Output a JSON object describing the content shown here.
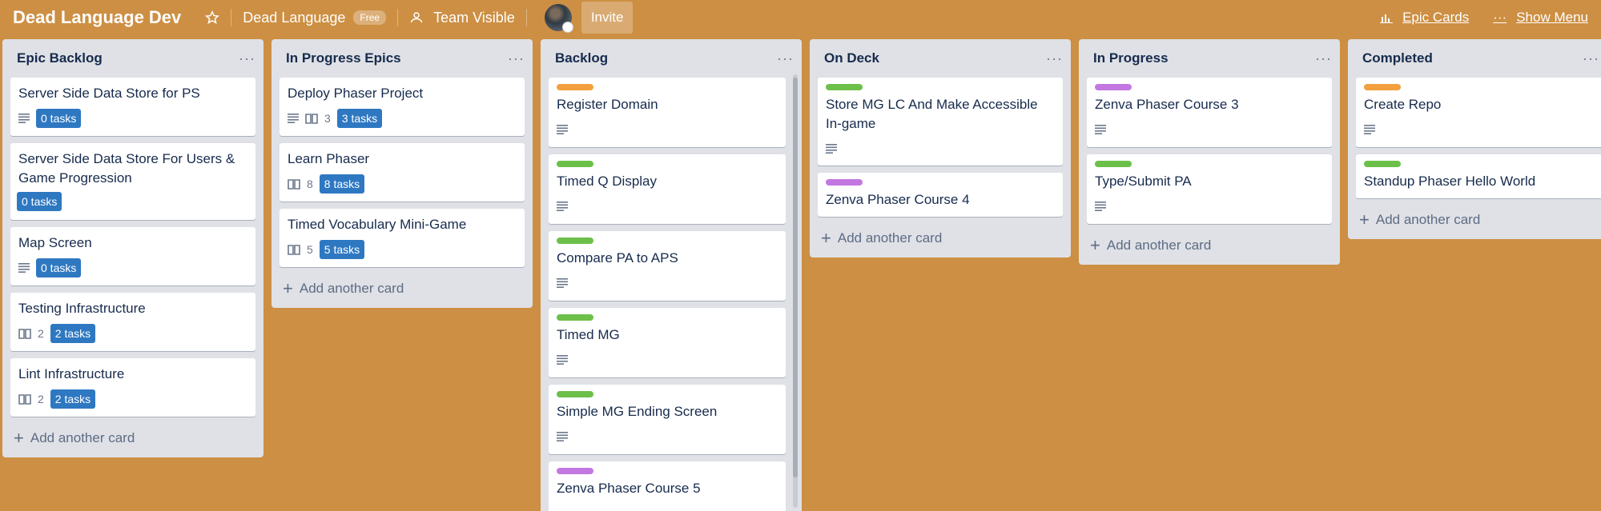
{
  "header": {
    "board_title": "Dead Language Dev",
    "team_name": "Dead Language",
    "free_badge": "Free",
    "visibility": "Team Visible",
    "invite_label": "Invite",
    "epic_cards_label": "Epic Cards",
    "show_menu_label": "Show Menu"
  },
  "colors": {
    "background": "#cd8f43",
    "label_orange": "#f2a03d",
    "label_green": "#6cc04a",
    "label_purple": "#c377e0",
    "task_badge": "#2e78c2"
  },
  "add_card_label": "Add another card",
  "lists": [
    {
      "title": "Epic Backlog",
      "cards": [
        {
          "title": "Server Side Data Store for PS",
          "tasks": "0 tasks"
        },
        {
          "title": "Server Side Data Store For Users & Game Progression",
          "tasks": "0 tasks"
        },
        {
          "title": "Map Screen",
          "tasks": "0 tasks"
        },
        {
          "title": "Testing Infrastructure",
          "checklist": "2",
          "tasks": "2 tasks"
        },
        {
          "title": "Lint Infrastructure",
          "checklist": "2",
          "tasks": "2 tasks"
        }
      ]
    },
    {
      "title": "In Progress Epics",
      "cards": [
        {
          "title": "Deploy Phaser Project",
          "checklist": "3",
          "tasks": "3 tasks"
        },
        {
          "title": "Learn Phaser",
          "checklist": "8",
          "tasks": "8 tasks"
        },
        {
          "title": "Timed Vocabulary Mini-Game",
          "checklist": "5",
          "tasks": "5 tasks"
        }
      ]
    },
    {
      "title": "Backlog",
      "cards": [
        {
          "title": "Register Domain",
          "label": "orange"
        },
        {
          "title": "Timed Q Display",
          "label": "green"
        },
        {
          "title": "Compare PA to APS",
          "label": "green"
        },
        {
          "title": "Timed MG",
          "label": "green"
        },
        {
          "title": "Simple MG Ending Screen",
          "label": "green"
        },
        {
          "title": "Zenva Phaser Course 5",
          "label": "purple"
        }
      ]
    },
    {
      "title": "On Deck",
      "cards": [
        {
          "title": "Store MG LC And Make Accessible In-game",
          "label": "green"
        },
        {
          "title": "Zenva Phaser Course 4",
          "label": "purple"
        }
      ]
    },
    {
      "title": "In Progress",
      "cards": [
        {
          "title": "Zenva Phaser Course 3",
          "label": "purple"
        },
        {
          "title": "Type/Submit PA",
          "label": "green"
        }
      ]
    },
    {
      "title": "Completed",
      "cards": [
        {
          "title": "Create Repo",
          "label": "orange"
        },
        {
          "title": "Standup Phaser Hello World",
          "label": "green"
        }
      ]
    }
  ]
}
